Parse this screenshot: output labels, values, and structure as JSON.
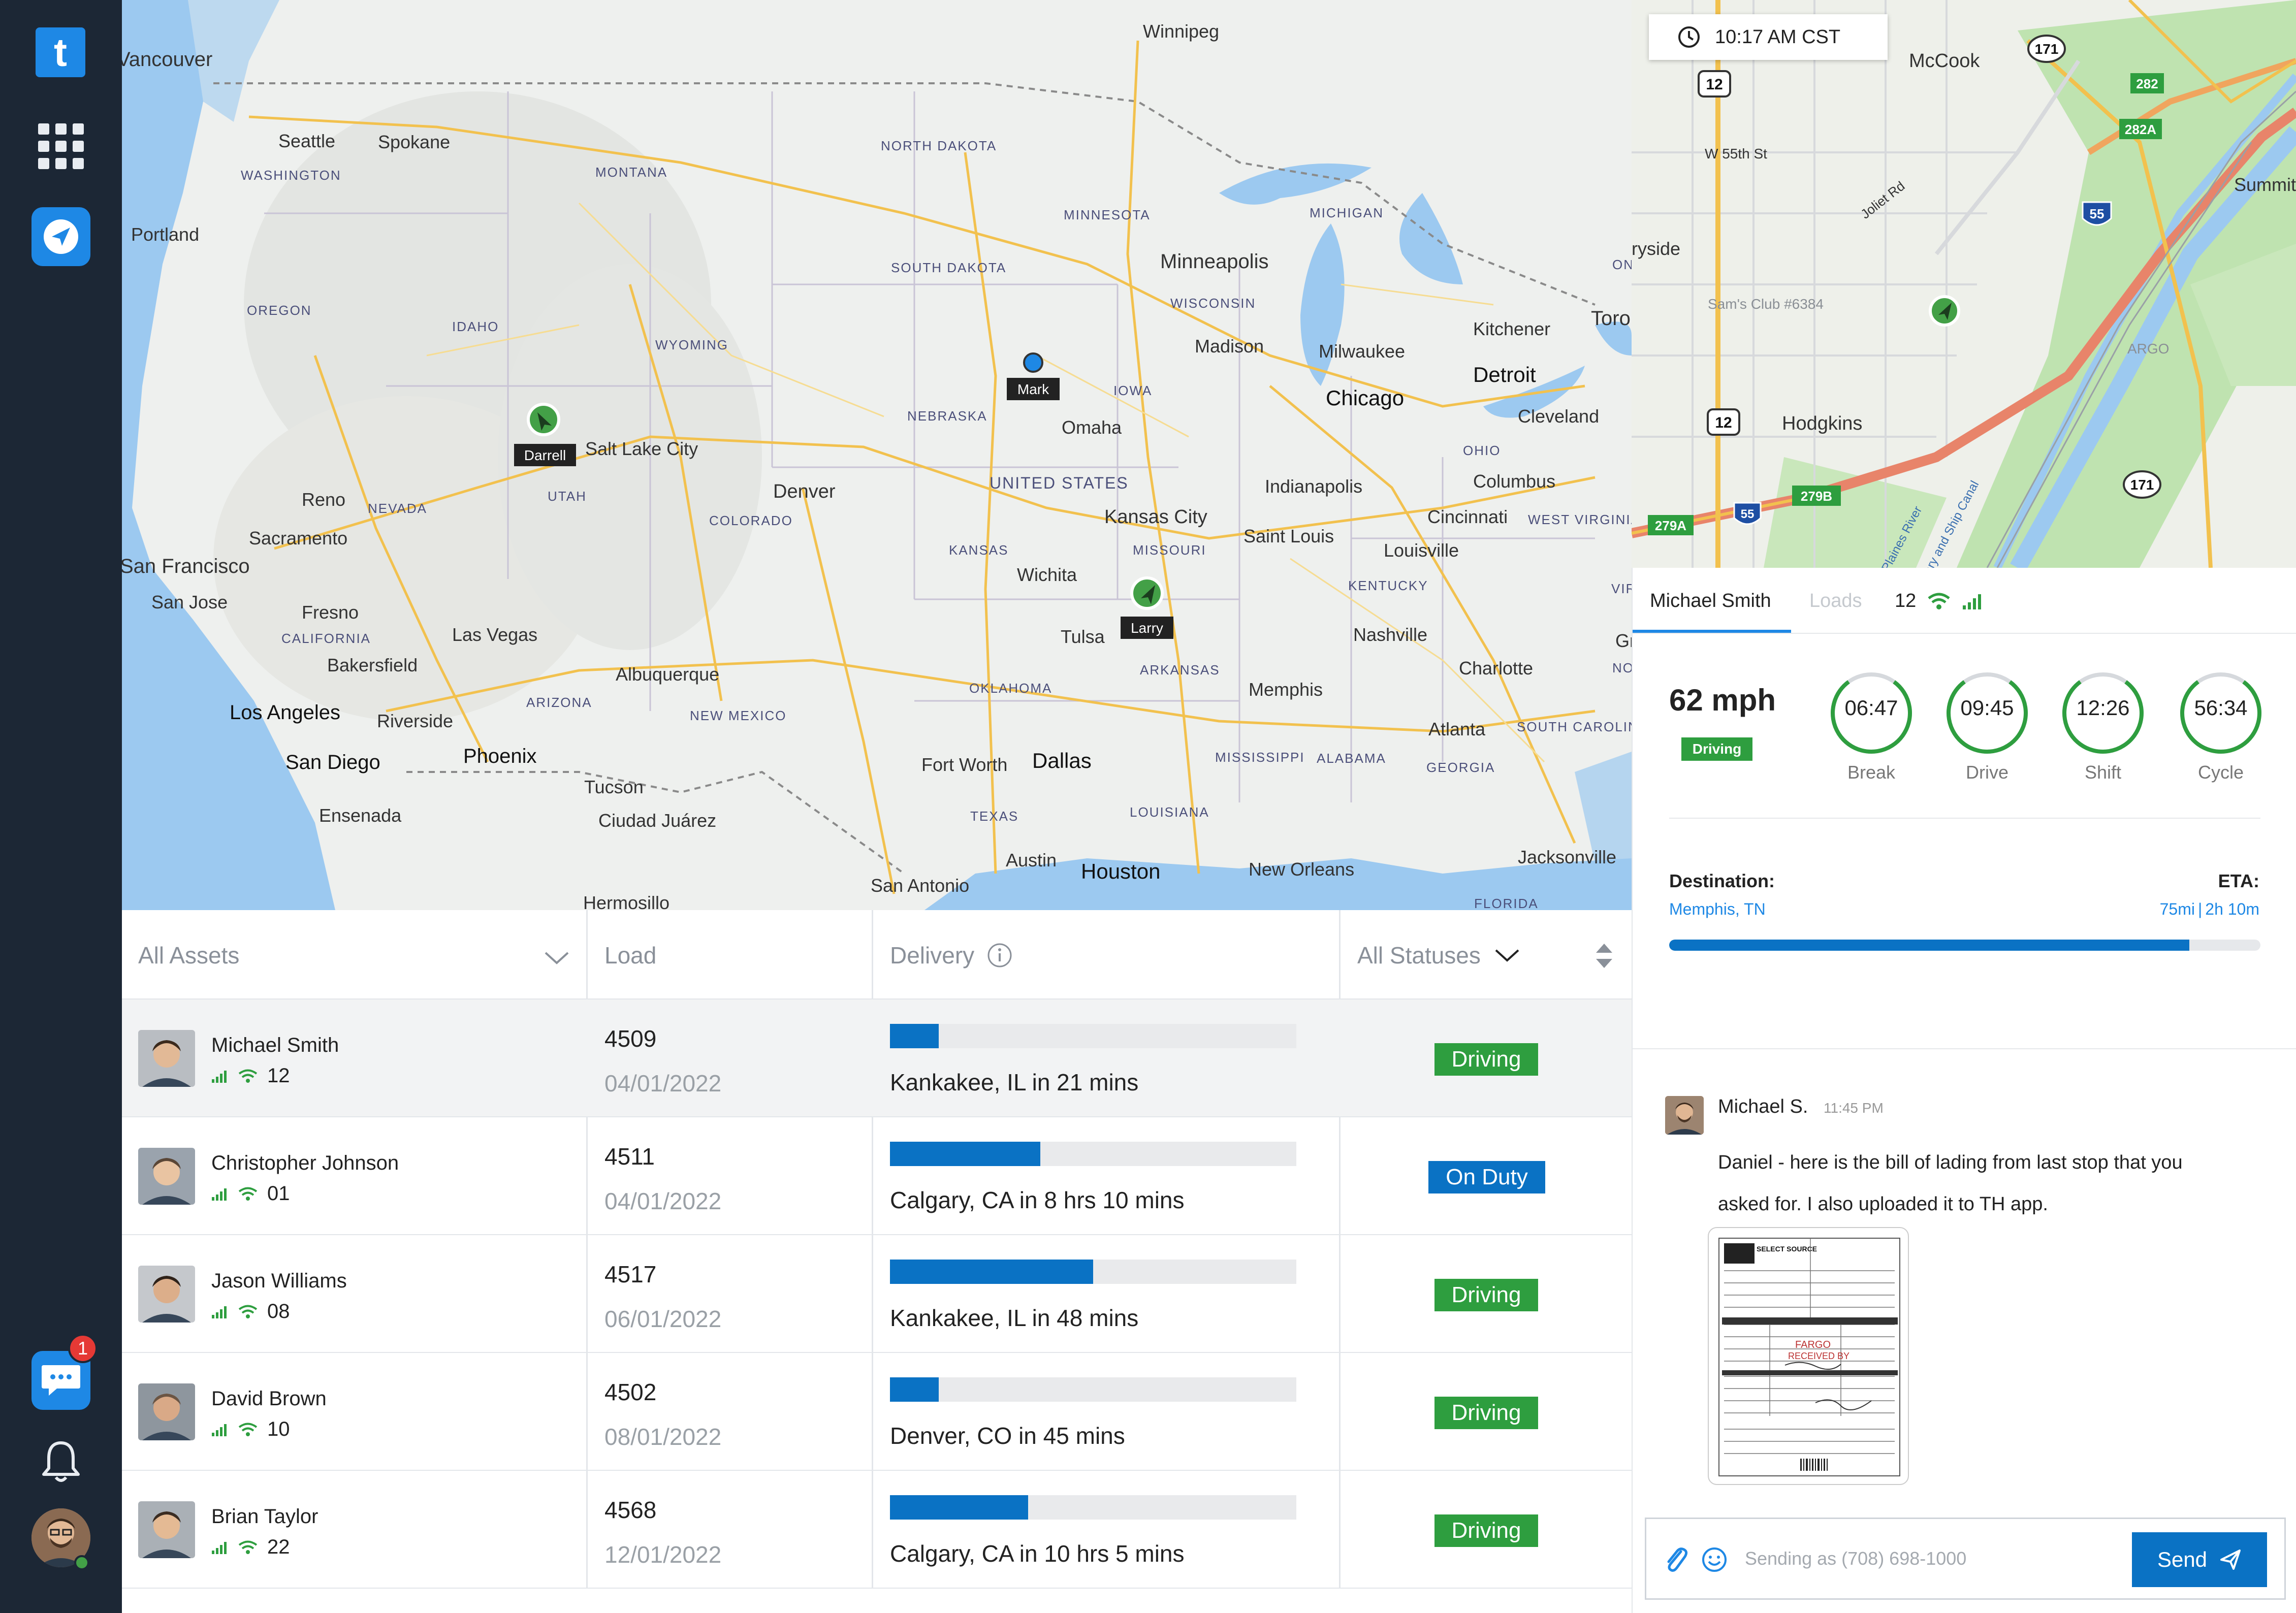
{
  "clock": {
    "time": "10:17 AM CST"
  },
  "nav": {
    "logo_letter": "t",
    "chat_badge": "1"
  },
  "map_labels": {
    "cities": [
      "Winnipeg",
      "Seattle",
      "Spokane",
      "Portland",
      "Minneapolis",
      "Chicago",
      "Milwaukee",
      "Detroit",
      "Toronto",
      "Kitchener",
      "Cleveland",
      "Columbus",
      "Indianapolis",
      "Cincinnati",
      "Louisville",
      "Nashville",
      "Saint Louis",
      "Kansas City",
      "Omaha",
      "Wichita",
      "Tulsa",
      "Dallas",
      "Fort Worth",
      "Austin",
      "Houston",
      "San Antonio",
      "Memphis",
      "Atlanta",
      "Charlotte",
      "Jacksonville",
      "New Orleans",
      "Denver",
      "Salt Lake City",
      "Reno",
      "Sacramento",
      "San Francisco",
      "San Jose",
      "Fresno",
      "Las Vegas",
      "Bakersfield",
      "Los Angeles",
      "Riverside",
      "San Diego",
      "Phoenix",
      "Tucson",
      "Albuquerque",
      "Ciudad Juárez",
      "Ensenada",
      "Hermosillo",
      "Madison",
      "Greensboro",
      "Vancouver"
    ],
    "states": [
      "WASHINGTON",
      "MONTANA",
      "NORTH DAKOTA",
      "MINNESOTA",
      "MICHIGAN",
      "SOUTH DAKOTA",
      "WISCONSIN",
      "OREGON",
      "IDAHO",
      "WYOMING",
      "NEBRASKA",
      "IOWA",
      "NEVADA",
      "UTAH",
      "COLORADO",
      "UNITED STATES",
      "KANSAS",
      "MISSOURI",
      "CALIFORNIA",
      "ARIZONA",
      "NEW MEXICO",
      "OKLAHOMA",
      "ARKANSAS",
      "TEXAS",
      "LOUISIANA",
      "MISSISSIPPI",
      "ALABAMA",
      "GEORGIA",
      "KENTUCKY",
      "OHIO",
      "WEST VIRGINIA",
      "VIRGINIA",
      "NORTH CAROLINA",
      "SOUTH CAROLINA",
      "FLORIDA",
      "ONTARIO"
    ]
  },
  "map_markers": [
    {
      "name": "Darrell",
      "icon": "navigation-arrow-icon",
      "color": "#43a047"
    },
    {
      "name": "Mark",
      "icon": "dot-icon",
      "color": "#1e88e5"
    },
    {
      "name": "Larry",
      "icon": "navigation-arrow-icon",
      "color": "#43a047"
    }
  ],
  "detail_map": {
    "labels": [
      "McCook",
      "W 55th St",
      "Joliet Rd",
      "Summit",
      "ryside",
      "Sam's Club #6384",
      "ARGO",
      "Hodgkins",
      "Des Plaines River",
      "Sanitary and Ship Canal"
    ],
    "shields": [
      "12",
      "171",
      "282",
      "282A",
      "55",
      "12",
      "279B",
      "55",
      "279A",
      "171"
    ]
  },
  "driver_panel": {
    "tab_driver": "Michael Smith",
    "tab_loads": "Loads",
    "tab_truck": "12",
    "speed": "62 mph",
    "status": "Driving",
    "gauges": [
      {
        "value": "06:47",
        "label": "Break",
        "fraction": 0.8
      },
      {
        "value": "09:45",
        "label": "Drive",
        "fraction": 0.8
      },
      {
        "value": "12:26",
        "label": "Shift",
        "fraction": 0.8
      },
      {
        "value": "56:34",
        "label": "Cycle",
        "fraction": 0.8
      }
    ],
    "destination_label": "Destination:",
    "destination": "Memphis, TN",
    "eta_label": "ETA:",
    "eta_distance": "75mi",
    "eta_time": "2h 10m",
    "route_progress": 0.88
  },
  "chat": {
    "sender": "Michael S.",
    "time": "11:45 PM",
    "message": "Daniel - here is the bill of lading from last stop that you asked for.  I also uploaded it to TH app.",
    "attachment": {
      "logo": "SELECT SOURCE",
      "stamp_line1": "FARGO",
      "stamp_line2": "RECEIVED BY"
    },
    "placeholder": "Sending as (708) 698-1000",
    "send_label": "Send"
  },
  "table": {
    "headers": {
      "assets": "All Assets",
      "load": "Load",
      "delivery": "Delivery",
      "statuses": "All Statuses"
    },
    "rows": [
      {
        "name": "Michael Smith",
        "truck": "12",
        "load": "4509",
        "date": "04/01/2022",
        "eta": "Kankakee, IL in 21 mins",
        "progress": 0.12,
        "status": "Driving",
        "status_color": "#2e9e3f"
      },
      {
        "name": "Christopher Johnson",
        "truck": "01",
        "load": "4511",
        "date": "04/01/2022",
        "eta": "Calgary, CA in 8 hrs 10 mins",
        "progress": 0.37,
        "status": "On Duty",
        "status_color": "#0a72c4"
      },
      {
        "name": "Jason Williams",
        "truck": "08",
        "load": "4517",
        "date": "06/01/2022",
        "eta": "Kankakee, IL in 48 mins",
        "progress": 0.5,
        "status": "Driving",
        "status_color": "#2e9e3f"
      },
      {
        "name": "David Brown",
        "truck": "10",
        "load": "4502",
        "date": "08/01/2022",
        "eta": "Denver, CO in 45 mins",
        "progress": 0.12,
        "status": "Driving",
        "status_color": "#2e9e3f"
      },
      {
        "name": "Brian Taylor",
        "truck": "22",
        "load": "4568",
        "date": "12/01/2022",
        "eta": "Calgary, CA in 10 hrs 5 mins",
        "progress": 0.34,
        "status": "Driving",
        "status_color": "#2e9e3f"
      }
    ]
  }
}
